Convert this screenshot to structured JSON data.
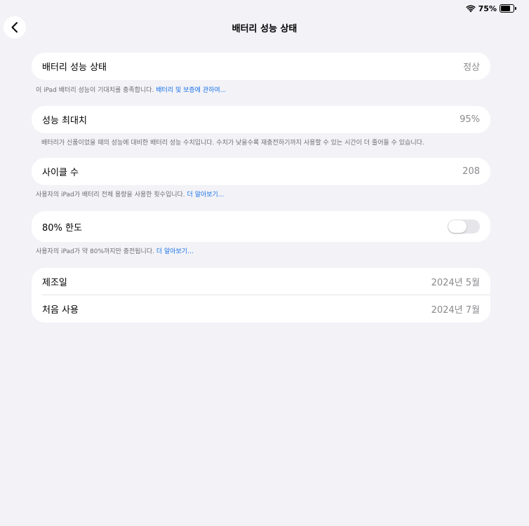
{
  "status_bar": {
    "battery_percent": "75%",
    "battery_level": 0.75
  },
  "nav": {
    "title": "배터리 성능 상태"
  },
  "health": {
    "label": "배터리 성능 상태",
    "value": "정상",
    "footnote_text": "이 iPad 배터리 성능이 기대치를 충족합니다.",
    "footnote_link": "배터리 및 보증에 관하여..."
  },
  "max_capacity": {
    "label": "성능 최대치",
    "value": "95%",
    "footnote_text": "배터리가 신품이었을 때의 성능에 대비한 배터리 성능 수치입니다. 수치가 낮을수록 재충전하기까지 사용할 수 있는 시간이 더 줄어들 수 있습니다."
  },
  "cycle_count": {
    "label": "사이클 수",
    "value": "208",
    "footnote_text": "사용자의 iPad가 배터리 전체 용량을 사용한 횟수입니다.",
    "footnote_link": "더 알아보기..."
  },
  "limit_80": {
    "label": "80% 한도",
    "enabled": false,
    "footnote_text": "사용자의 iPad가 약 80%까지만 충전됩니다.",
    "footnote_link": "더 알아보기..."
  },
  "dates": {
    "manufacture_label": "제조일",
    "manufacture_value": "2024년 5월",
    "first_use_label": "처음 사용",
    "first_use_value": "2024년 7월"
  }
}
